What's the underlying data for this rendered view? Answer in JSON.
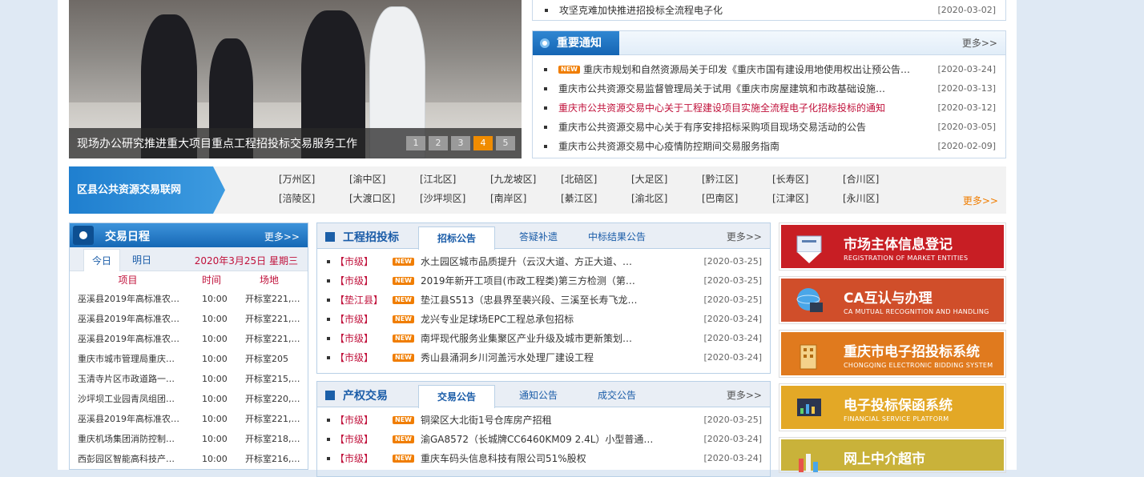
{
  "slideshow": {
    "caption": "现场办公研究推进重大项目重点工程招投标交易服务工作",
    "pages": [
      "1",
      "2",
      "3",
      "4",
      "5"
    ],
    "active_page": "4"
  },
  "top_news": {
    "title": "攻坚克难加快推进招投标全流程电子化",
    "date": "[2020-03-02]"
  },
  "notices": {
    "title": "重要通知",
    "more": "更多>>",
    "new_label": "NEW",
    "items": [
      {
        "title": "重庆市规划和自然资源局关于印发《重庆市国有建设用地使用权出让预公告…",
        "date": "[2020-03-24]"
      },
      {
        "title": "重庆市公共资源交易监督管理局关于试用《重庆市房屋建筑和市政基础设施…",
        "date": "[2020-03-13]"
      },
      {
        "title": "重庆市公共资源交易中心关于工程建设项目实施全流程电子化招标投标的通知",
        "date": "[2020-03-12]"
      },
      {
        "title": "重庆市公共资源交易中心关于有序安排招标采购项目现场交易活动的公告",
        "date": "[2020-03-05]"
      },
      {
        "title": "重庆市公共资源交易中心疫情防控期间交易服务指南",
        "date": "[2020-02-09]"
      }
    ]
  },
  "districts": {
    "label": "区县公共资源交易联网",
    "more": "更多>>",
    "items": [
      "[万州区]",
      "[渝中区]",
      "[江北区]",
      "[九龙坡区]",
      "[北碚区]",
      "[大足区]",
      "[黔江区]",
      "[长寿区]",
      "[合川区]",
      "[涪陵区]",
      "[大渡口区]",
      "[沙坪坝区]",
      "[南岸区]",
      "[綦江区]",
      "[渝北区]",
      "[巴南区]",
      "[江津区]",
      "[永川区]"
    ]
  },
  "schedule": {
    "title": "交易日程",
    "more": "更多>>",
    "tab_today": "今日",
    "tab_tomorrow": "明日",
    "date": "2020年3月25日 星期三",
    "col_item": "项目",
    "col_time": "时间",
    "col_place": "场地",
    "rows": [
      {
        "item": "巫溪县2019年高标准农…",
        "time": "10:00",
        "place": "开标室221,…"
      },
      {
        "item": "巫溪县2019年高标准农…",
        "time": "10:00",
        "place": "开标室221,…"
      },
      {
        "item": "巫溪县2019年高标准农…",
        "time": "10:00",
        "place": "开标室221,…"
      },
      {
        "item": "重庆市城市管理局重庆…",
        "time": "10:00",
        "place": "开标室205"
      },
      {
        "item": "玉清寺片区市政道路一…",
        "time": "10:00",
        "place": "开标室215,…"
      },
      {
        "item": "沙坪坝工业园青凤组团…",
        "time": "10:00",
        "place": "开标室220,…"
      },
      {
        "item": "巫溪县2019年高标准农…",
        "time": "10:00",
        "place": "开标室221,…"
      },
      {
        "item": "重庆机场集团消防控制…",
        "time": "10:00",
        "place": "开标室218,…"
      },
      {
        "item": "西彭园区智能高科技产…",
        "time": "10:00",
        "place": "开标室216,…"
      }
    ]
  },
  "engineering": {
    "title": "工程招投标",
    "tabs": [
      "招标公告",
      "答疑补遗",
      "中标结果公告"
    ],
    "more": "更多>>",
    "new_label": "NEW",
    "items": [
      {
        "level": "【市级】",
        "title": "水土园区城市品质提升（云汉大道、方正大道、…",
        "date": "[2020-03-25]"
      },
      {
        "level": "【市级】",
        "title": "2019年新开工项目(市政工程类)第三方检测（第…",
        "date": "[2020-03-25]"
      },
      {
        "level": "【垫江县】",
        "title": "垫江县S513（忠县界至裴兴段、三溪至长寿飞龙…",
        "date": "[2020-03-25]"
      },
      {
        "level": "【市级】",
        "title": "龙兴专业足球场EPC工程总承包招标",
        "date": "[2020-03-24]"
      },
      {
        "level": "【市级】",
        "title": "南坪现代服务业集聚区产业升级及城市更新策划…",
        "date": "[2020-03-24]"
      },
      {
        "level": "【市级】",
        "title": "秀山县涌洞乡川河盖污水处理厂建设工程",
        "date": "[2020-03-24]"
      }
    ]
  },
  "property": {
    "title": "产权交易",
    "tabs": [
      "交易公告",
      "通知公告",
      "成交公告"
    ],
    "more": "更多>>",
    "new_label": "NEW",
    "items": [
      {
        "level": "【市级】",
        "title": "铜梁区大北街1号仓库房产招租",
        "date": "[2020-03-25]"
      },
      {
        "level": "【市级】",
        "title": "渝GA8572（长城牌CC6460KM09 2.4L）小型普通…",
        "date": "[2020-03-24]"
      },
      {
        "level": "【市级】",
        "title": "重庆车码头信息科技有限公司51%股权",
        "date": "[2020-03-24]"
      }
    ]
  },
  "banners": [
    {
      "title": "市场主体信息登记",
      "subtitle": "REGISTRATION OF MARKET ENTITIES",
      "color": "#c81e24",
      "icon": "registration-icon"
    },
    {
      "title": "CA互认与办理",
      "subtitle": "CA MUTUAL RECOGNITION AND HANDLING",
      "color": "#d04e2a",
      "icon": "globe-computer-icon"
    },
    {
      "title": "重庆市电子招投标系统",
      "subtitle": "CHONGQING ELECTRONIC BIDDING SYSTEM",
      "color": "#e07a1e",
      "icon": "building-icon"
    },
    {
      "title": "电子投标保函系统",
      "subtitle": "FINANCIAL SERVICE PLATFORM",
      "color": "#e3a826",
      "icon": "chart-screen-icon"
    },
    {
      "title": "网上中介超市",
      "subtitle": "",
      "color": "#c9b23a",
      "icon": "chart-icon"
    }
  ]
}
